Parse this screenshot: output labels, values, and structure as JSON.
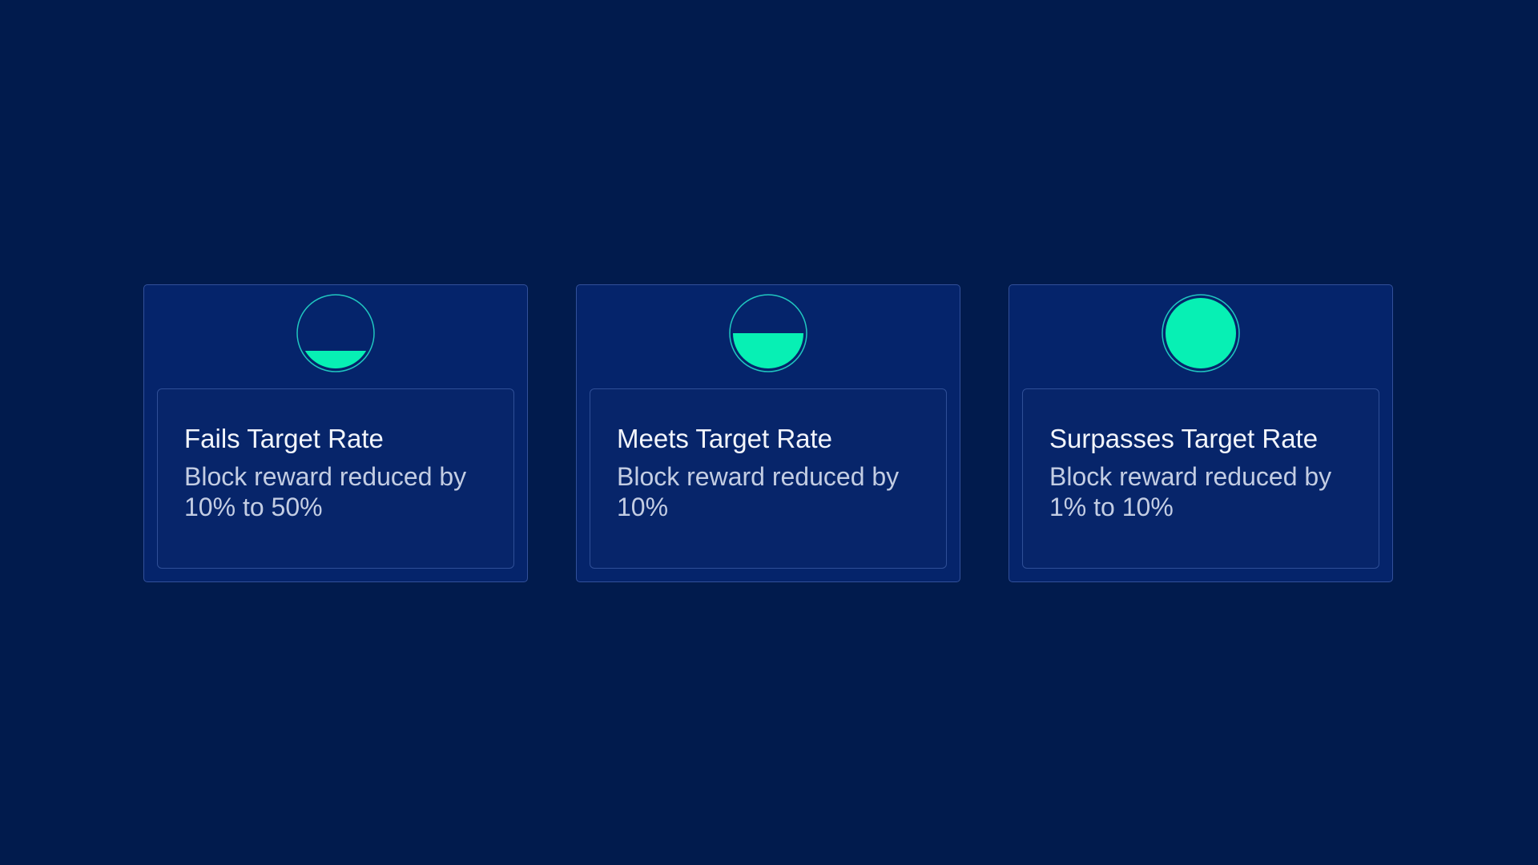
{
  "colors": {
    "background": "#011b4d",
    "card": "#05246b",
    "accent": "#07f0b4",
    "ring": "#20c6c0"
  },
  "cards": [
    {
      "icon": "quarter-fill-gauge-icon",
      "fill_fraction": 0.25,
      "title": "Fails Target Rate",
      "description": "Block reward reduced by 10% to 50%"
    },
    {
      "icon": "half-fill-gauge-icon",
      "fill_fraction": 0.5,
      "title": "Meets Target Rate",
      "description": "Block reward reduced by 10%"
    },
    {
      "icon": "full-fill-gauge-icon",
      "fill_fraction": 1.0,
      "title": "Surpasses Target Rate",
      "description": "Block reward reduced by 1% to 10%"
    }
  ]
}
